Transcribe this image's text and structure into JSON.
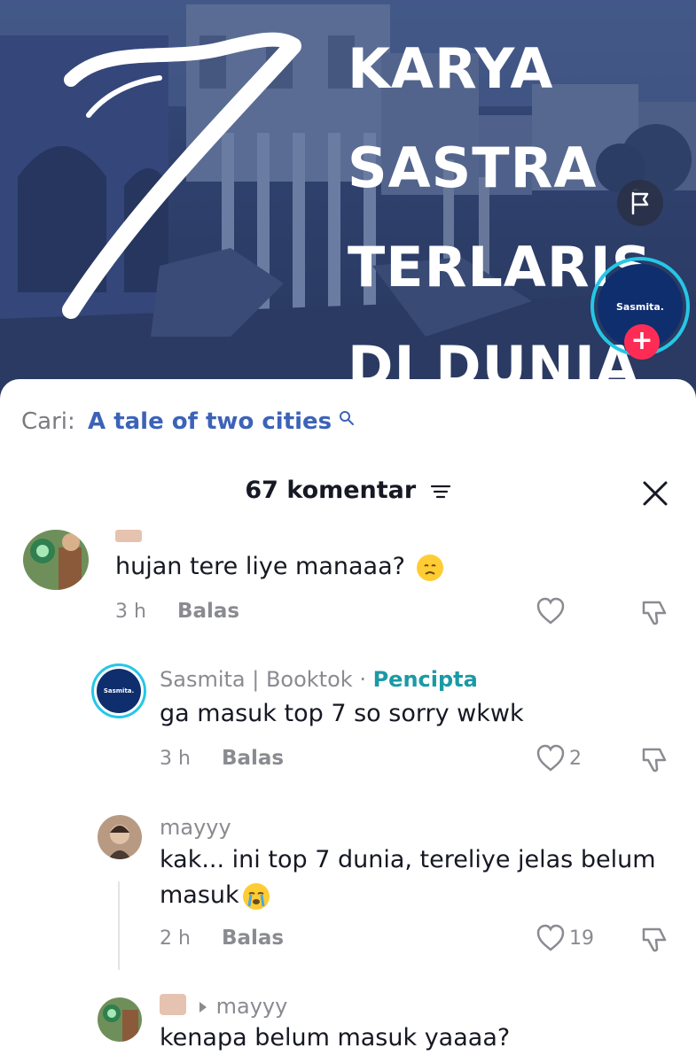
{
  "video": {
    "big_number": "7",
    "title_lines": [
      "KARYA",
      "SASTRA",
      "TERLARIS",
      "DI DUNIA"
    ],
    "creator_avatar_text": "Sasmita.",
    "follow_symbol": "+"
  },
  "search": {
    "label": "Cari:",
    "query": "A tale of two cities"
  },
  "header": {
    "count_label": "67 komentar"
  },
  "comments": [
    {
      "text": "hujan tere liye manaaa?",
      "time": "3 h",
      "reply_label": "Balas",
      "likes": ""
    },
    {
      "user": "Sasmita | Booktok",
      "separator": " · ",
      "creator_tag": "Pencipta",
      "avatar_text": "Sasmita.",
      "text": "ga masuk top 7 so sorry wkwk",
      "time": "3 h",
      "reply_label": "Balas",
      "likes": "2"
    },
    {
      "user": "mayyy",
      "text_line1": "kak... ini top 7 dunia, tereliye jelas belum",
      "text_line2": "masuk",
      "time": "2 h",
      "reply_label": "Balas",
      "likes": "19"
    },
    {
      "reply_to": "mayyy",
      "text": "kenapa belum masuk yaaaa?"
    }
  ],
  "colors": {
    "accent_blue": "#3c63b8",
    "creator_teal": "#1a9aa5",
    "follow_red": "#fe2c55",
    "avatar_ring": "#25c7e6"
  }
}
